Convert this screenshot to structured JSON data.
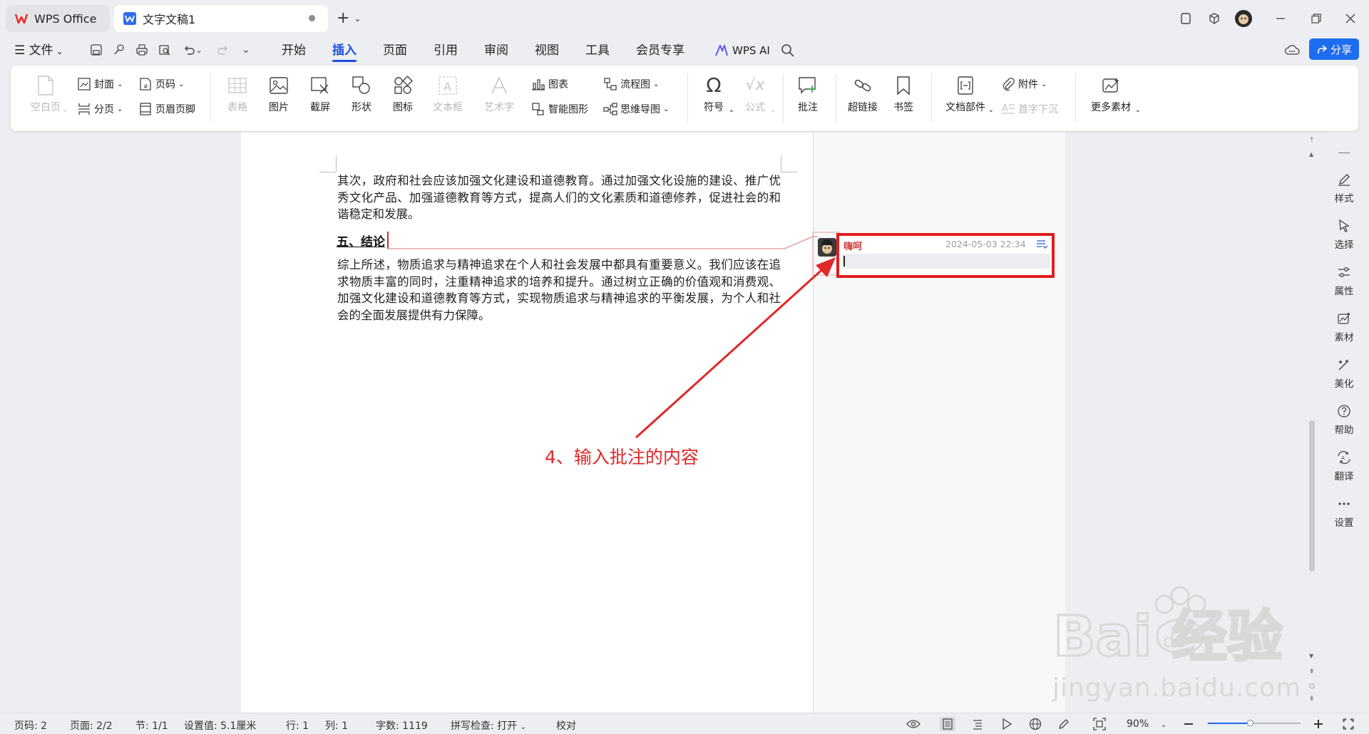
{
  "tabs": [
    {
      "label": "WPS Office"
    },
    {
      "label": "文字文稿1"
    }
  ],
  "quick_access": [
    "save-icon",
    "format-painter-icon",
    "print-icon",
    "print-preview-icon",
    "undo-icon",
    "redo-icon",
    "more-icon"
  ],
  "menu": {
    "file": "文件",
    "items": [
      "开始",
      "插入",
      "页面",
      "引用",
      "审阅",
      "视图",
      "工具",
      "会员专享"
    ],
    "active": "插入",
    "ai": "WPS AI",
    "share": "分享"
  },
  "ribbon": {
    "blank_page": "空白页",
    "cover": "封面",
    "page_break": "分页",
    "page_number": "页码",
    "header_footer": "页眉页脚",
    "table": "表格",
    "picture": "图片",
    "screenshot": "截屏",
    "shape": "形状",
    "icon": "图标",
    "textbox": "文本框",
    "wordart": "艺术字",
    "chart": "图表",
    "smartart": "智能图形",
    "flowchart": "流程图",
    "mindmap": "思维导图",
    "symbol": "符号",
    "formula": "公式",
    "comment": "批注",
    "hyperlink": "超链接",
    "bookmark": "书签",
    "doc_parts": "文档部件",
    "attachment": "附件",
    "drop_cap": "首字下沉",
    "more_materials": "更多素材"
  },
  "document": {
    "para1": "其次，政府和社会应该加强文化建设和道德教育。通过加强文化设施的建设、推广优秀文化产品、加强道德教育等方式，提高人们的文化素质和道德修养，促进社会的和谐稳定和发展。",
    "heading": "五、结论",
    "para2": "综上所述，物质追求与精神追求在个人和社会发展中都具有重要意义。我们应该在追求物质丰富的同时，注重精神追求的培养和提升。通过树立正确的价值观和消费观、加强文化建设和道德教育等方式，实现物质追求与精神追求的平衡发展，为个人和社会的全面发展提供有力保障。"
  },
  "comment": {
    "author": "嗨呵",
    "time": "2024-05-03 22:34",
    "content": ""
  },
  "annotation": "4、输入批注的内容",
  "sidebar": [
    "样式",
    "选择",
    "属性",
    "素材",
    "美化",
    "帮助",
    "翻译",
    "设置"
  ],
  "status": {
    "page_code": "页码: 2",
    "page": "页面: 2/2",
    "section": "节: 1/1",
    "setting": "设置值: 5.1厘米",
    "row": "行: 1",
    "col": "列: 1",
    "words": "字数: 1119",
    "spellcheck": "拼写检查: 打开",
    "proof": "校对",
    "zoom": "90%",
    "zoom_level": 0.45
  },
  "watermark": {
    "text": "jingyan.baidu.com",
    "logo_text": "Bai 经验",
    "logo_du": "du"
  },
  "colors": {
    "accent": "#1a4fe0",
    "share": "#1e6cf0",
    "highlight": "#e11d1d",
    "annotation": "#e02828"
  }
}
